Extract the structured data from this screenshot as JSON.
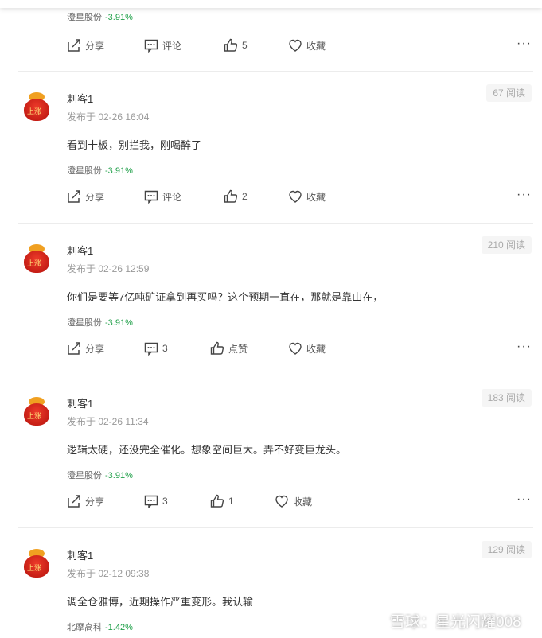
{
  "top_post": {
    "stock": {
      "name": "澄星股份",
      "change": "-3.91%"
    },
    "actions": {
      "share": "分享",
      "comment": "评论",
      "like": "5",
      "favorite": "收藏"
    }
  },
  "posts": [
    {
      "username": "刺客1",
      "time": "发布于 02-26 16:04",
      "reads": "67 阅读",
      "content": "看到十板，别拦我，刚喝醉了",
      "stock": {
        "name": "澄星股份",
        "change": "-3.91%"
      },
      "actions": {
        "share": "分享",
        "comment": "评论",
        "like": "2",
        "favorite": "收藏"
      }
    },
    {
      "username": "刺客1",
      "time": "发布于 02-26 12:59",
      "reads": "210 阅读",
      "content": "你们是要等7亿吨矿证拿到再买吗？这个预期一直在，那就是靠山在，",
      "stock": {
        "name": "澄星股份",
        "change": "-3.91%"
      },
      "actions": {
        "share": "分享",
        "comment": "3",
        "like": "点赞",
        "favorite": "收藏"
      }
    },
    {
      "username": "刺客1",
      "time": "发布于 02-26 11:34",
      "reads": "183 阅读",
      "content": "逻辑太硬，还没完全催化。想象空间巨大。弄不好变巨龙头。",
      "stock": {
        "name": "澄星股份",
        "change": "-3.91%"
      },
      "actions": {
        "share": "分享",
        "comment": "3",
        "like": "1",
        "favorite": "收藏"
      }
    },
    {
      "username": "刺客1",
      "time": "发布于 02-12 09:38",
      "reads": "129 阅读",
      "content": "调全仓雅博，近期操作严重变形。我认输",
      "stock": {
        "name": "北摩高科",
        "change": "-1.42%"
      }
    }
  ],
  "avatar_text": "上涨",
  "more_glyph": "···",
  "watermark": "雪球：星光闪耀008",
  "colors": {
    "down_green": "#21a04a",
    "avatar_red": "#d61f16"
  }
}
